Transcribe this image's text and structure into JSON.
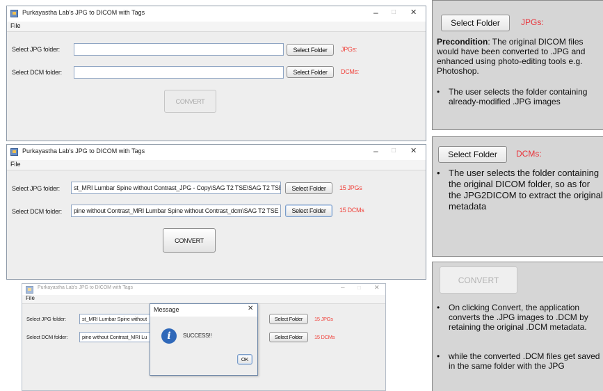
{
  "app": {
    "title": "Purkayastha Lab's JPG to DICOM with Tags",
    "menu_file": "File",
    "minimize_glyph": "–",
    "maximize_glyph": "□",
    "close_glyph": "✕"
  },
  "labels": {
    "jpg_folder": "Select JPG folder:",
    "dcm_folder": "Select DCM folder:",
    "select_folder": "Select Folder",
    "convert": "CONVERT"
  },
  "window1": {
    "jpg_path": "",
    "dcm_path": "",
    "jpg_status": "JPGs:",
    "dcm_status": "DCMs:"
  },
  "window2": {
    "jpg_path": "st_MRI Lumbar Spine without Contrast_JPG - Copy\\SAG T2 TSE\\SAG T2 TSE",
    "dcm_path": "pine without Contrast_MRI Lumbar Spine without Contrast_dcm\\SAG T2 TSE",
    "jpg_status": "15 JPGs",
    "dcm_status": "15 DCMs"
  },
  "window3": {
    "jpg_path": "st_MRI Lumbar Spine without",
    "dcm_path": "pine without Contrast_MRI Lu",
    "jpg_status": "15 JPGs",
    "dcm_status": "15 DCMs"
  },
  "dialog": {
    "title": "Message",
    "message": "SUCCESS!!",
    "ok_label": "OK"
  },
  "panel1": {
    "button_label": "Select Folder",
    "tag": "JPGs:",
    "precondition_label": "Precondition",
    "precondition_text": ": The original DICOM files would have been converted to .JPG and enhanced using photo-editing tools e.g. Photoshop.",
    "bullets": [
      "The  user selects the folder containing already-modified .JPG images"
    ]
  },
  "panel2": {
    "button_label": "Select Folder",
    "tag": "DCMs:",
    "bullets": [
      "The user selects the folder containing the original DICOM folder, so as for the JPG2DICOM to extract the original metadata"
    ]
  },
  "panel3": {
    "button_label": "CONVERT",
    "bullets": [
      "On clicking Convert, the application converts the .JPG images to .DCM by retaining the original .DCM metadata.",
      " while the converted .DCM files get saved in the same folder with the JPG"
    ]
  },
  "bullet_char": "•",
  "colors": {
    "status_red": "#f0413a",
    "panel_gray": "#d6d6d6",
    "info_blue": "#2f68b9"
  },
  "icons": {
    "app": "java-app-icon",
    "info": "information-icon"
  }
}
